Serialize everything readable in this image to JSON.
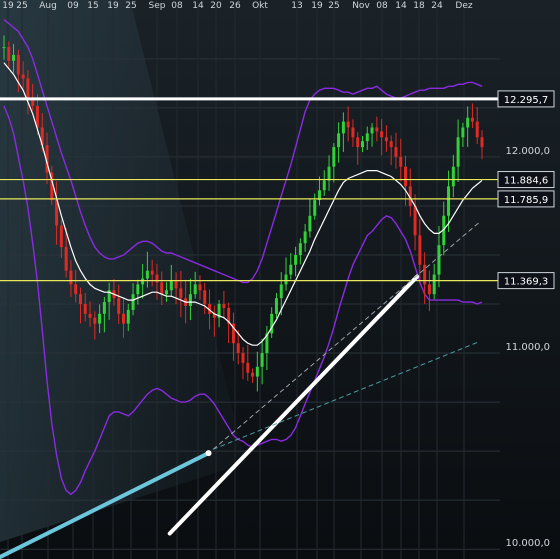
{
  "chart_data": {
    "type": "candlestick",
    "x_tick_labels": [
      "19",
      "25",
      "Aug",
      "09",
      "15",
      "19",
      "25",
      "Sep",
      "08",
      "14",
      "20",
      "26",
      "Okt",
      "13",
      "19",
      "25",
      "Nov",
      "08",
      "14",
      "18",
      "24",
      "Dez"
    ],
    "y_axis": {
      "ylim": [
        9950,
        12800
      ],
      "scale": "linear",
      "tick_labels": [
        "12.000,0",
        "11.000,0",
        "10.000,0"
      ],
      "tick_values": [
        12000,
        11000,
        10000
      ]
    },
    "price_levels": [
      {
        "value": 12295.7,
        "label": "12.295,7",
        "style": "white-thick"
      },
      {
        "value": 11884.6,
        "label": "11.884,6",
        "style": "yellow"
      },
      {
        "value": 11785.9,
        "label": "11.785,9",
        "style": "yellow"
      },
      {
        "value": 11369.3,
        "label": "11.369,3",
        "style": "yellow"
      }
    ],
    "trend_lines": [
      {
        "name": "support",
        "color": "#ffffff",
        "start": [
          0.35,
          10080
        ],
        "end": [
          0.86,
          11390
        ]
      },
      {
        "name": "prior-trend",
        "color": "#6cc7dc",
        "start": [
          0.0,
          9960
        ],
        "end": [
          0.43,
          10490
        ]
      },
      {
        "name": "projection-upper",
        "color": "#9aa3ab",
        "dashed": true,
        "start": [
          0.44,
          10510
        ],
        "end": [
          0.99,
          11670
        ]
      },
      {
        "name": "projection-lower",
        "color": "#4fa3a8",
        "dashed": true,
        "start": [
          0.44,
          10510
        ],
        "end": [
          0.99,
          11060
        ]
      }
    ],
    "closes": [
      12560,
      12490,
      12520,
      12420,
      12400,
      12300,
      12260,
      12150,
      12060,
      11920,
      11780,
      11650,
      11540,
      11420,
      11350,
      11300,
      11250,
      11200,
      11180,
      11150,
      11200,
      11260,
      11320,
      11280,
      11200,
      11150,
      11220,
      11300,
      11350,
      11380,
      11420,
      11400,
      11360,
      11300,
      11320,
      11370,
      11330,
      11280,
      11240,
      11300,
      11350,
      11320,
      11250,
      11200,
      11180,
      11250,
      11230,
      11150,
      11050,
      11000,
      10950,
      10900,
      10880,
      10930,
      11000,
      11100,
      11200,
      11280,
      11350,
      11400,
      11450,
      11500,
      11560,
      11620,
      11700,
      11780,
      11830,
      11880,
      11950,
      12050,
      12120,
      12180,
      12150,
      12100,
      12050,
      12080,
      12120,
      12150,
      12130,
      12100,
      12080,
      12050,
      12000,
      11950,
      11850,
      11750,
      11600,
      11450,
      11350,
      11300,
      11400,
      11550,
      11700,
      11850,
      11950,
      12100,
      12150,
      12200,
      12180,
      12100,
      12050
    ],
    "ma_fast": [
      12480,
      12450,
      12420,
      12380,
      12340,
      12280,
      12220,
      12140,
      12060,
      11970,
      11880,
      11790,
      11700,
      11620,
      11540,
      11470,
      11420,
      11380,
      11350,
      11330,
      11320,
      11310,
      11310,
      11300,
      11290,
      11280,
      11270,
      11270,
      11280,
      11290,
      11300,
      11310,
      11310,
      11300,
      11290,
      11290,
      11280,
      11270,
      11260,
      11260,
      11260,
      11250,
      11240,
      11220,
      11200,
      11190,
      11180,
      11160,
      11130,
      11100,
      11070,
      11050,
      11040,
      11040,
      11060,
      11090,
      11130,
      11170,
      11220,
      11270,
      11320,
      11370,
      11420,
      11470,
      11520,
      11580,
      11630,
      11680,
      11730,
      11780,
      11830,
      11870,
      11890,
      11900,
      11910,
      11920,
      11930,
      11930,
      11930,
      11920,
      11910,
      11900,
      11880,
      11860,
      11830,
      11790,
      11750,
      11700,
      11660,
      11630,
      11610,
      11610,
      11630,
      11660,
      11700,
      11740,
      11780,
      11810,
      11840,
      11860,
      11880
    ],
    "band_upper": [
      12700,
      12680,
      12660,
      12640,
      12600,
      12560,
      12500,
      12420,
      12340,
      12260,
      12180,
      12100,
      12020,
      11950,
      11880,
      11800,
      11720,
      11650,
      11590,
      11540,
      11510,
      11490,
      11480,
      11480,
      11490,
      11500,
      11520,
      11540,
      11560,
      11570,
      11570,
      11560,
      11540,
      11520,
      11510,
      11510,
      11500,
      11490,
      11480,
      11470,
      11460,
      11450,
      11440,
      11430,
      11420,
      11410,
      11400,
      11390,
      11380,
      11370,
      11360,
      11360,
      11380,
      11420,
      11480,
      11560,
      11640,
      11720,
      11800,
      11880,
      11960,
      12050,
      12140,
      12230,
      12290,
      12320,
      12340,
      12350,
      12350,
      12350,
      12340,
      12330,
      12330,
      12320,
      12330,
      12340,
      12350,
      12350,
      12360,
      12340,
      12320,
      12310,
      12300,
      12300,
      12310,
      12320,
      12330,
      12340,
      12340,
      12350,
      12350,
      12350,
      12350,
      12360,
      12360,
      12370,
      12370,
      12380,
      12380,
      12370,
      12360
    ],
    "band_lower": [
      12260,
      12200,
      12120,
      12000,
      11880,
      11740,
      11560,
      11360,
      11120,
      10860,
      10640,
      10480,
      10360,
      10300,
      10280,
      10300,
      10340,
      10400,
      10450,
      10500,
      10560,
      10620,
      10680,
      10700,
      10700,
      10690,
      10680,
      10700,
      10730,
      10760,
      10790,
      10810,
      10820,
      10810,
      10790,
      10770,
      10760,
      10750,
      10750,
      10760,
      10780,
      10790,
      10790,
      10770,
      10740,
      10700,
      10660,
      10620,
      10580,
      10560,
      10550,
      10530,
      10520,
      10530,
      10540,
      10550,
      10560,
      10560,
      10550,
      10560,
      10580,
      10620,
      10680,
      10740,
      10800,
      10860,
      10920,
      10980,
      11050,
      11130,
      11220,
      11300,
      11380,
      11450,
      11500,
      11550,
      11600,
      11620,
      11650,
      11680,
      11700,
      11690,
      11660,
      11620,
      11580,
      11520,
      11440,
      11360,
      11300,
      11270,
      11270,
      11270,
      11270,
      11270,
      11270,
      11270,
      11260,
      11260,
      11260,
      11250,
      11260
    ],
    "colors": {
      "background": "#0d1117",
      "up": "#32d13a",
      "down": "#e02a24",
      "ma": "#ffffff",
      "band": "#8a2be2",
      "level_yellow": "#e8e85a",
      "level_white": "#ffffff"
    }
  }
}
